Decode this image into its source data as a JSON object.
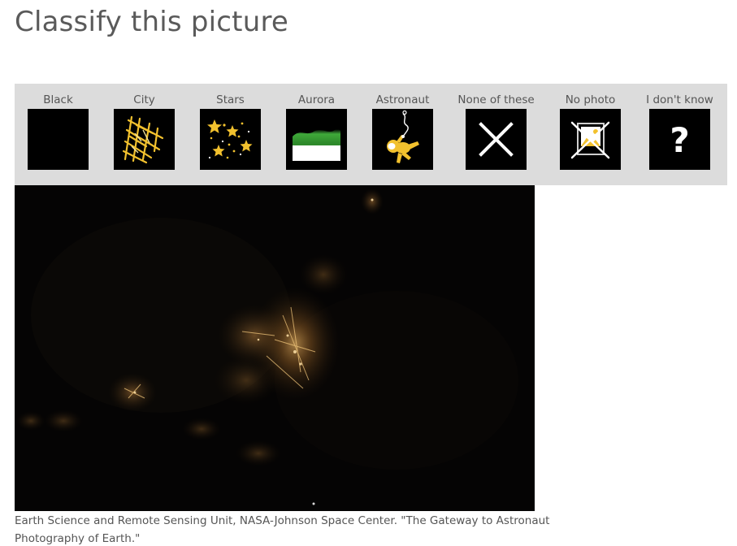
{
  "page": {
    "title": "Classify this picture"
  },
  "options": [
    {
      "label": "Black",
      "icon": "black-square-icon"
    },
    {
      "label": "City",
      "icon": "city-lights-icon"
    },
    {
      "label": "Stars",
      "icon": "stars-icon"
    },
    {
      "label": "Aurora",
      "icon": "aurora-icon"
    },
    {
      "label": "Astronaut",
      "icon": "astronaut-icon"
    },
    {
      "label": "None of these",
      "icon": "cross-icon"
    },
    {
      "label": "No photo",
      "icon": "no-photo-icon"
    },
    {
      "label": "I don't know",
      "icon": "question-mark-icon"
    }
  ],
  "photo": {
    "description_icon": "night-earth-photo"
  },
  "credit": {
    "text": "Earth Science and Remote Sensing Unit, NASA-Johnson Space Center. \"The Gateway to Astronaut Photography of Earth.\""
  },
  "colors": {
    "bar_bg": "#dcdcdc",
    "tile_bg": "#000000",
    "accent_yellow": "#f2c12e",
    "aurora_green": "#3fa93a",
    "text_gray": "#555555"
  }
}
